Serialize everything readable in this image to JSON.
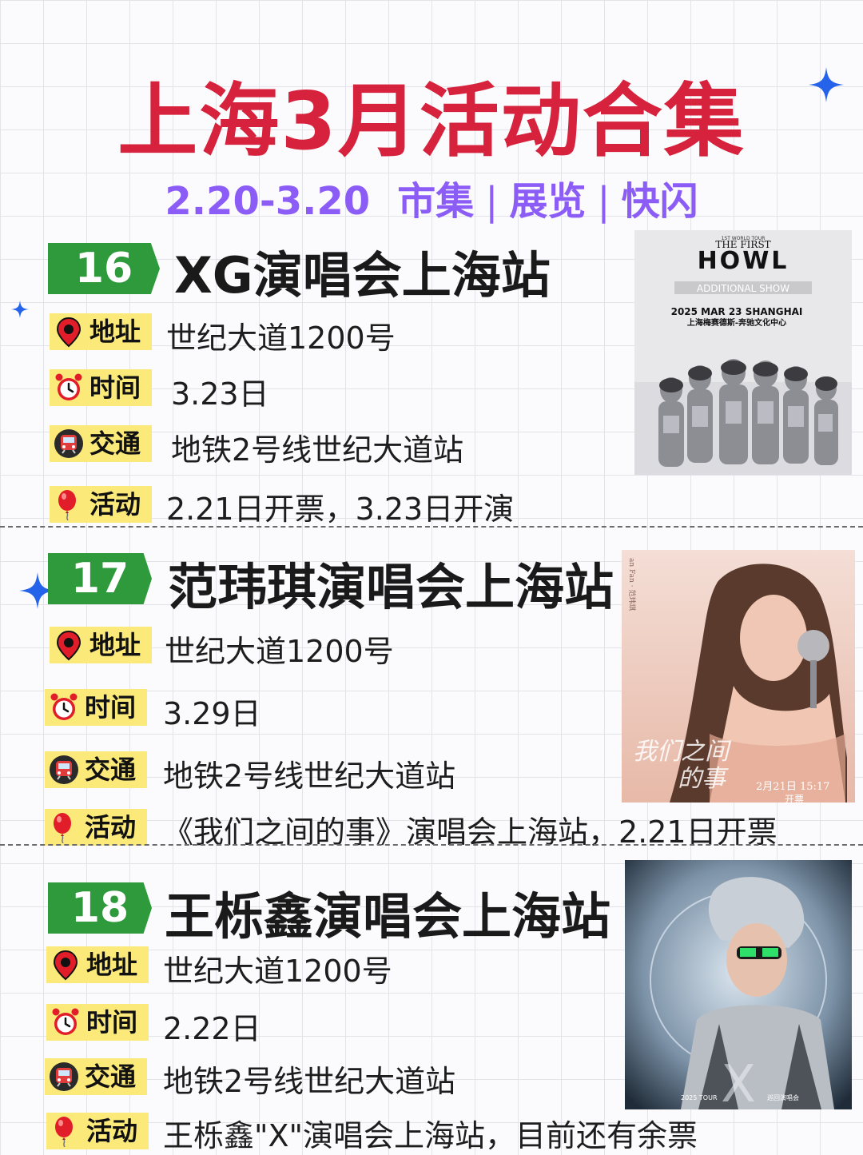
{
  "header": {
    "title": "上海3月活动合集",
    "date_range": "2.20-3.20",
    "categories": [
      "市集",
      "展览",
      "快闪"
    ],
    "separator": "|"
  },
  "labels": {
    "address": "地址",
    "time": "时间",
    "transport": "交通",
    "activity": "活动"
  },
  "events": [
    {
      "number": "16",
      "title": "XG演唱会上海站",
      "address": "世纪大道1200号",
      "time": "3.23日",
      "transport": "地铁2号线世纪大道站",
      "activity": "2.21日开票，3.23日开演",
      "poster": {
        "tour": "1ST WORLD TOUR",
        "headline_1": "THE FIRST",
        "headline_2": "HOWL",
        "additional": "ADDITIONAL SHOW",
        "date_city": "2025 MAR 23 SHANGHAI",
        "venue": "上海梅赛德斯-奔驰文化中心"
      }
    },
    {
      "number": "17",
      "title": "范玮琪演唱会上海站",
      "address": "世纪大道1200号",
      "time": "3.29日",
      "transport": "地铁2号线世纪大道站",
      "activity": "《我们之间的事》演唱会上海站，2.21日开票",
      "poster": {
        "side_text": "an Fan · 范玮琪",
        "script_1": "我们之间",
        "script_2": "的事",
        "date_time": "2月21日 15:17",
        "sale": "开票"
      }
    },
    {
      "number": "18",
      "title": "王栎鑫演唱会上海站",
      "address": "世纪大道1200号",
      "time": "2.22日",
      "transport": "地铁2号线世纪大道站",
      "activity": "王栎鑫\"X\"演唱会上海站，目前还有余票",
      "poster": {
        "big_letter": "X",
        "tour": "2025 TOUR",
        "tour_cn": "巡回演唱会"
      }
    }
  ],
  "colors": {
    "title": "#d6223c",
    "subtitle": "#8b5cf6",
    "number_tag": "#2e9a3c",
    "label_bg": "#fbe97a",
    "sparkle": "#2563eb"
  },
  "icons": {
    "address": "map-pin-icon",
    "time": "alarm-clock-icon",
    "transport": "metro-train-icon",
    "activity": "red-balloon-icon",
    "decor": "sparkle-icon"
  }
}
